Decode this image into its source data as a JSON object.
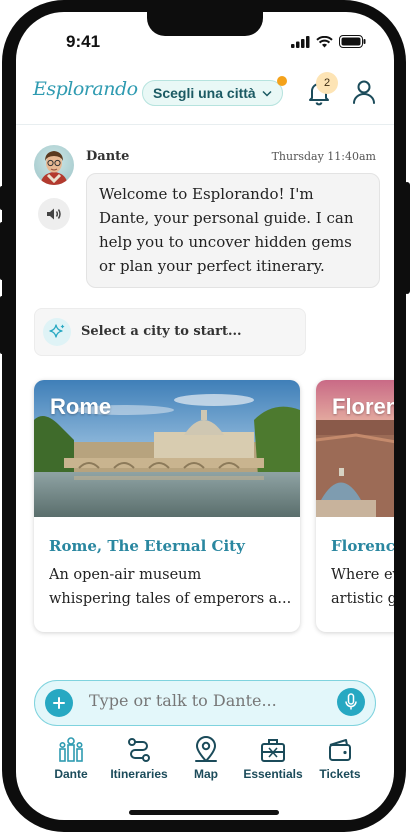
{
  "status_bar": {
    "time": "9:41"
  },
  "header": {
    "logo": "Esplorando",
    "city_selector": "Scegli una città",
    "notification_count": "2",
    "colors": {
      "accent": "#2f9bb1",
      "badge": "#fde4b5",
      "dot": "#f4a21b"
    }
  },
  "chat": {
    "sender": "Dante",
    "timestamp": "Thursday 11:40am",
    "message": "Welcome to Esplorando! I'm Dante, your personal guide. I can help you to uncover hidden gems or plan your perfect itinerary."
  },
  "select_city_prompt": "Select a city to start...",
  "cards": [
    {
      "image_label": "Rome",
      "title": "Rome, The Eternal City",
      "description_line1": "An open-air museum",
      "description_line2": "whispering tales of emperors a..."
    },
    {
      "image_label": "Florence",
      "title": "Florence",
      "description_line1": "Where every",
      "description_line2": "artistic g"
    }
  ],
  "input": {
    "placeholder": "Type or talk to Dante..."
  },
  "nav": [
    {
      "label": "Dante",
      "icon": "dante-icon"
    },
    {
      "label": "Itineraries",
      "icon": "route-icon"
    },
    {
      "label": "Map",
      "icon": "map-pin-icon"
    },
    {
      "label": "Essentials",
      "icon": "essentials-bag-icon"
    },
    {
      "label": "Tickets",
      "icon": "wallet-icon"
    }
  ]
}
